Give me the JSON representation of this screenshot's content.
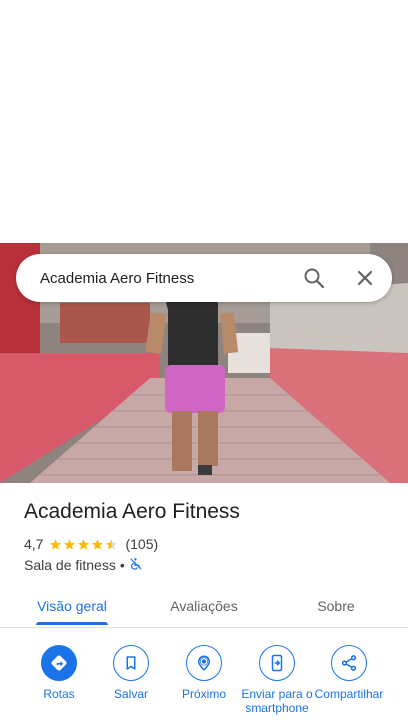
{
  "search": {
    "value": "Academia Aero Fitness",
    "search_icon": "search-icon",
    "close_icon": "close-icon"
  },
  "photo": {
    "description_icon": "place-photo"
  },
  "place": {
    "name": "Academia Aero Fitness",
    "rating": "4,7",
    "stars_filled": 4.5,
    "review_count": "(105)",
    "category": "Sala de fitness",
    "separator": "•",
    "accessibility_icon": "no-wheelchair-icon"
  },
  "tabs": [
    {
      "label": "Visão geral",
      "active": true
    },
    {
      "label": "Avaliações",
      "active": false
    },
    {
      "label": "Sobre",
      "active": false
    }
  ],
  "actions": [
    {
      "label": "Rotas",
      "icon": "directions-icon"
    },
    {
      "label": "Salvar",
      "icon": "bookmark-icon"
    },
    {
      "label": "Próximo",
      "icon": "nearby-icon"
    },
    {
      "label": "Enviar para o smartphone",
      "icon": "send-to-phone-icon"
    },
    {
      "label": "Compartilhar",
      "icon": "share-icon"
    }
  ],
  "colors": {
    "accent": "#1a73e8",
    "star": "#fbbc04",
    "text_primary": "#202124",
    "text_secondary": "#5f6368"
  }
}
